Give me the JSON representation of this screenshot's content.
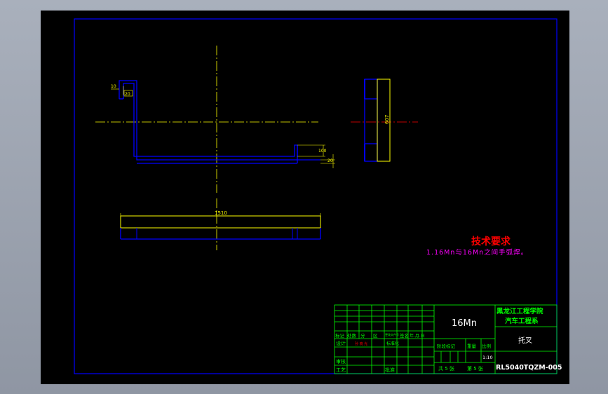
{
  "dimensions": {
    "top_left_width": "10",
    "top_left_inner": "20",
    "right_step": "100",
    "right_small": "20",
    "side_height": "607",
    "bottom_length": "1510"
  },
  "notes": {
    "title": "技术要求",
    "item": "1.16Mn与16Mn之间手弧焊。"
  },
  "title_block": {
    "school": "黑龙江工程学院",
    "department": "汽车工程系",
    "material": "16Mn",
    "part_name": "托叉",
    "drawing_number": "RL5040TQZM-005",
    "scale": "1:10",
    "sheet_total": "共 5 张",
    "sheet_index": "第 5 张",
    "header_labels": [
      "标记",
      "处数",
      "分",
      "区",
      "更改文件号",
      "签名",
      "年.月.日"
    ],
    "role_design": "设计",
    "role_review": "审核",
    "role_process": "工艺",
    "designer": "孙 晓 光",
    "standard": "标准化",
    "approve": "批准",
    "stage_mark": "阶段标记",
    "weight": "重量",
    "ratio": "比例"
  },
  "colors": {
    "outline": "#0000ff",
    "centerline": "#ffff00",
    "dimension": "#ffff00",
    "table": "#00ff00",
    "title_red": "#ff0000",
    "white": "#ffffff"
  }
}
